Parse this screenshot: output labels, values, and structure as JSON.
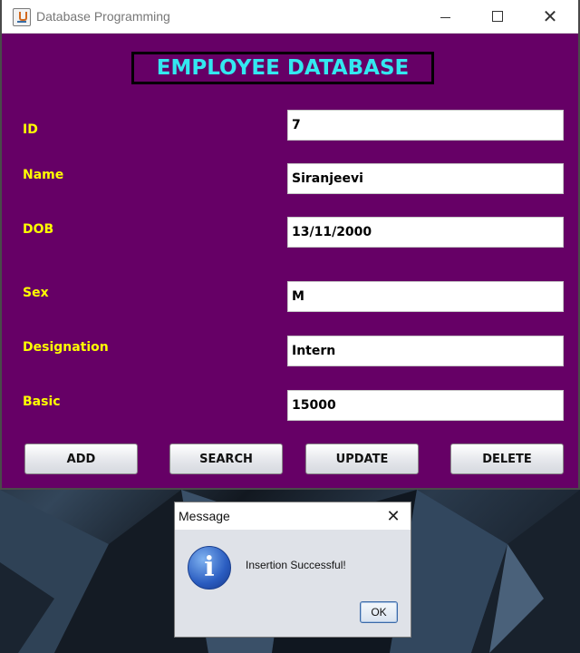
{
  "window": {
    "title": "Database Programming"
  },
  "form": {
    "header": "EMPLOYEE DATABASE",
    "fields": [
      {
        "label": "ID",
        "value": "7"
      },
      {
        "label": "Name",
        "value": "Siranjeevi"
      },
      {
        "label": "DOB",
        "value": "13/11/2000"
      },
      {
        "label": "Sex",
        "value": "M"
      },
      {
        "label": "Designation",
        "value": "Intern"
      },
      {
        "label": "Basic",
        "value": "15000"
      }
    ],
    "buttons": {
      "add": "ADD",
      "search": "SEARCH",
      "update": "UPDATE",
      "delete": "DELETE"
    }
  },
  "dialog": {
    "title": "Message",
    "message": "Insertion Successful!",
    "ok": "OK",
    "icon": "info-icon"
  },
  "colors": {
    "form_background": "#660066",
    "header_text": "#33e8f0",
    "label_text": "#ffff00"
  }
}
